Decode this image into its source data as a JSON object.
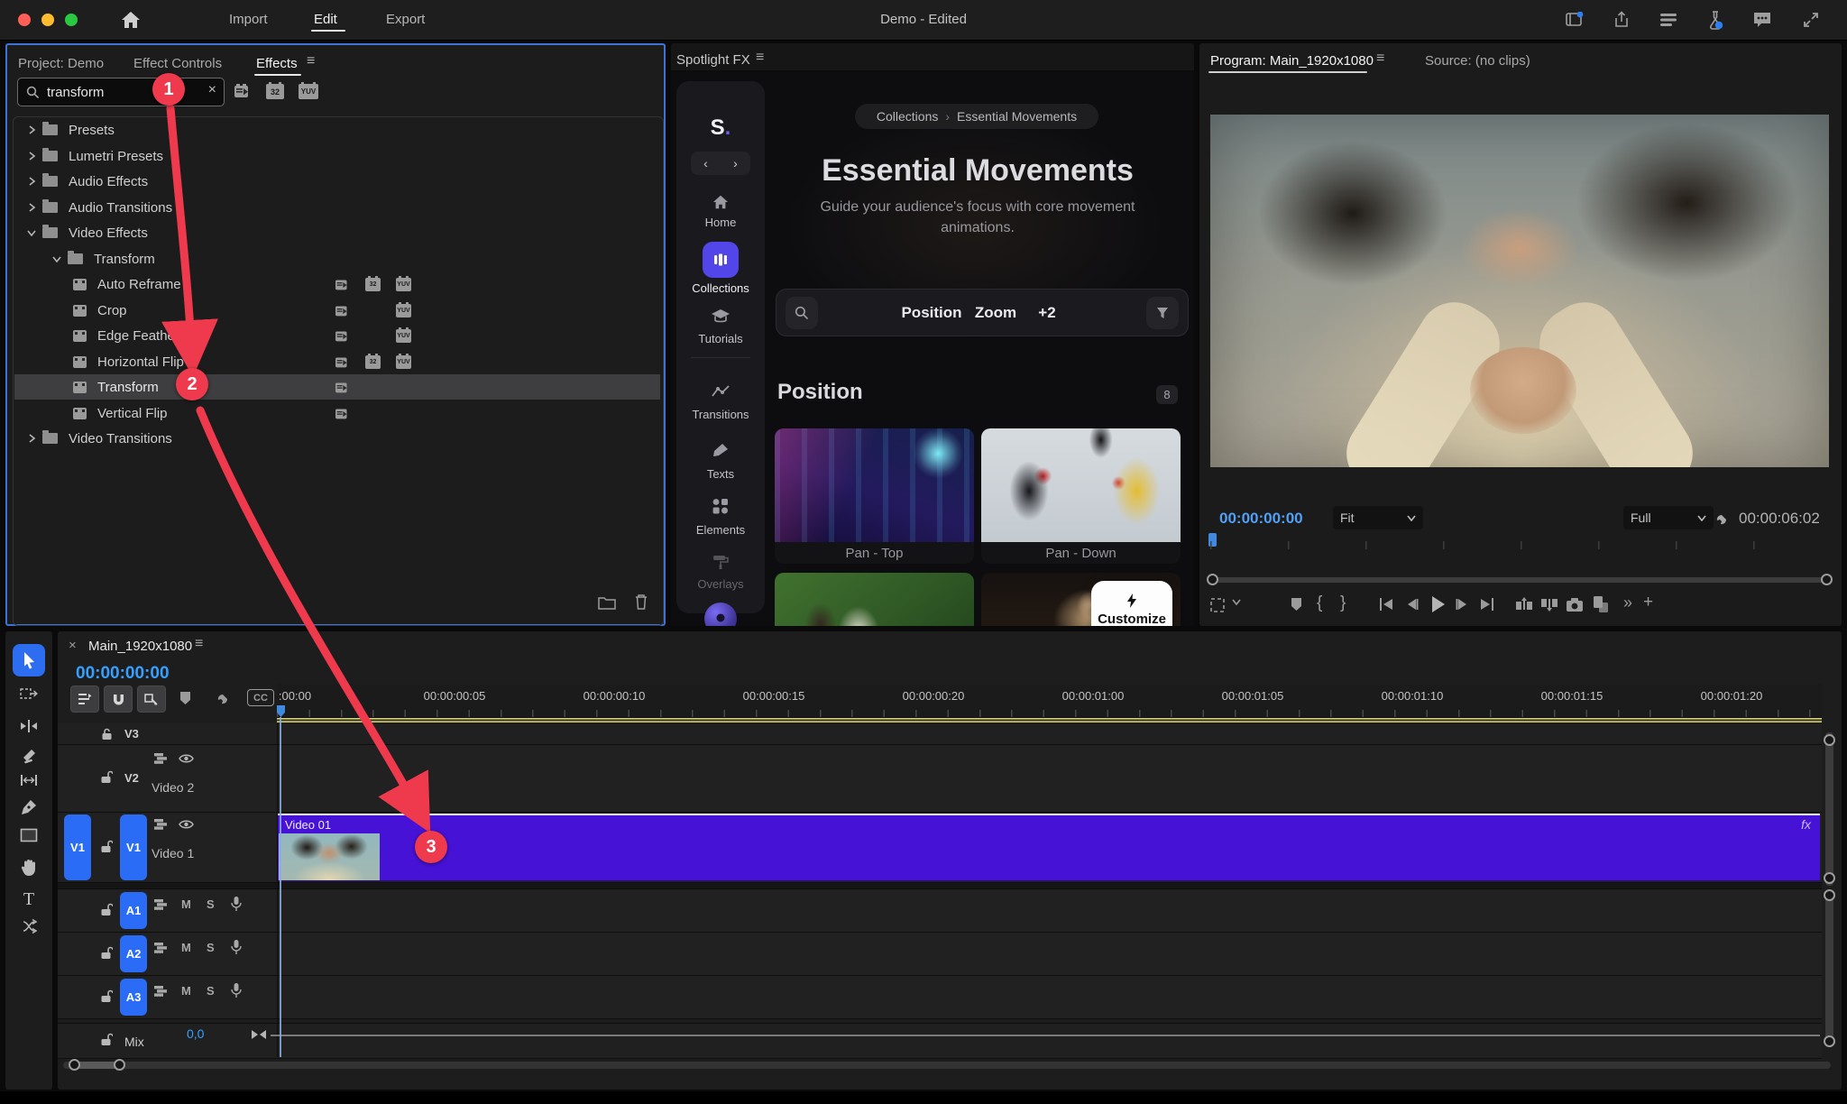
{
  "app_bar": {
    "nav_import": "Import",
    "nav_edit": "Edit",
    "nav_export": "Export",
    "title": "Demo - Edited"
  },
  "left_panel": {
    "tab_project": "Project: Demo",
    "tab_effect_controls": "Effect Controls",
    "tab_effects": "Effects",
    "search_value": "transform",
    "badge_32": "32",
    "badge_yuv": "YUV",
    "tree": [
      {
        "label": "Presets"
      },
      {
        "label": "Lumetri Presets"
      },
      {
        "label": "Audio Effects"
      },
      {
        "label": "Audio Transitions"
      },
      {
        "label": "Video Effects"
      },
      {
        "label": "Transform"
      },
      {
        "label": "Auto Reframe"
      },
      {
        "label": "Crop"
      },
      {
        "label": "Edge Feather"
      },
      {
        "label": "Horizontal Flip"
      },
      {
        "label": "Transform"
      },
      {
        "label": "Vertical Flip"
      },
      {
        "label": "Video Transitions"
      }
    ]
  },
  "spotlight": {
    "panel_title": "Spotlight FX",
    "logo": "S",
    "logo_dot": ".",
    "sidebar": {
      "home": "Home",
      "collections": "Collections",
      "tutorials": "Tutorials",
      "transitions": "Transitions",
      "texts": "Texts",
      "elements": "Elements",
      "overlays": "Overlays"
    },
    "breadcrumb": {
      "parent": "Collections",
      "separator": "›",
      "current": "Essential Movements"
    },
    "hero_title": "Essential Movements",
    "hero_subtitle": "Guide your audience's focus with core movement animations.",
    "chips": [
      "Position",
      "Zoom",
      "+2"
    ],
    "section_title": "Position",
    "section_count": "8",
    "cards": [
      {
        "label": "Pan - Top"
      },
      {
        "label": "Pan - Down"
      }
    ],
    "customize_label": "Customize"
  },
  "program": {
    "tab_program": "Program: Main_1920x1080",
    "tab_source": "Source: (no clips)",
    "timecode_current": "00:00:00:00",
    "fit_label": "Fit",
    "quality_label": "Full",
    "timecode_duration": "00:00:06:02"
  },
  "timeline": {
    "close": "×",
    "tab_title": "Main_1920x1080",
    "timecode": "00:00:00:00",
    "cc_label": "CC",
    "ruler": [
      ":00:00",
      "00:00:00:05",
      "00:00:00:10",
      "00:00:00:15",
      "00:00:00:20",
      "00:00:01:00",
      "00:00:01:05",
      "00:00:01:10",
      "00:00:01:15",
      "00:00:01:20"
    ],
    "tracks": {
      "v3": "V3",
      "v2": "V2",
      "v2_name": "Video 2",
      "v1": "V1",
      "v1_name": "Video 1",
      "a1": "A1",
      "a2": "A2",
      "a3": "A3",
      "mix": "Mix",
      "mix_value": "0,0",
      "mute": "M",
      "solo": "S"
    },
    "clip": {
      "label": "Video 01",
      "fx": "fx"
    }
  },
  "annotations": {
    "step1": "1",
    "step2": "2",
    "step3": "3"
  }
}
